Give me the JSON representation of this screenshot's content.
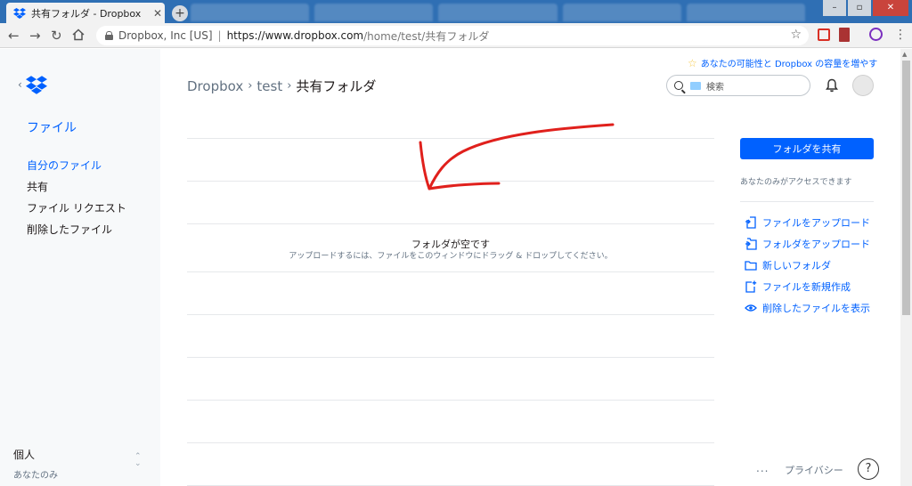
{
  "browser": {
    "tab_title": "共有フォルダ - Dropbox",
    "tab_close": "✕",
    "new_tab": "+",
    "site_identity": "Dropbox, Inc [US]",
    "url_base": "https://www.dropbox.com",
    "url_path": "/home/test/共有フォルダ",
    "window_controls": [
      "–",
      "▫",
      "✕"
    ]
  },
  "sidebar": {
    "heading": "ファイル",
    "items": [
      {
        "label": "自分のファイル",
        "active": true
      },
      {
        "label": "共有",
        "active": false
      },
      {
        "label": "ファイル リクエスト",
        "active": false
      },
      {
        "label": "削除したファイル",
        "active": false
      }
    ],
    "account_name": "個人",
    "account_sub": "あなたのみ"
  },
  "main": {
    "upsell": "あなたの可能性と Dropbox の容量を増やす",
    "breadcrumb": [
      "Dropbox",
      "test",
      "共有フォルダ"
    ],
    "breadcrumb_sep": "›",
    "search_placeholder": "検索",
    "empty_title": "フォルダが空です",
    "empty_sub": "アップロードするには、ファイルをこのウィンドウにドラッグ & ドロップしてください。"
  },
  "right_panel": {
    "share_button": "フォルダを共有",
    "access_text": "あなたのみがアクセスできます",
    "actions": [
      {
        "label": "ファイルをアップロード",
        "icon": "upload-file-icon"
      },
      {
        "label": "フォルダをアップロード",
        "icon": "upload-folder-icon"
      },
      {
        "label": "新しいフォルダ",
        "icon": "folder-icon"
      },
      {
        "label": "ファイルを新規作成",
        "icon": "new-file-icon"
      },
      {
        "label": "削除したファイルを表示",
        "icon": "eye-icon"
      }
    ]
  },
  "footer": {
    "more": "...",
    "privacy": "プライバシー",
    "help": "?"
  },
  "colors": {
    "accent": "#0061ff",
    "annotation_arrow": "#e0201c"
  }
}
